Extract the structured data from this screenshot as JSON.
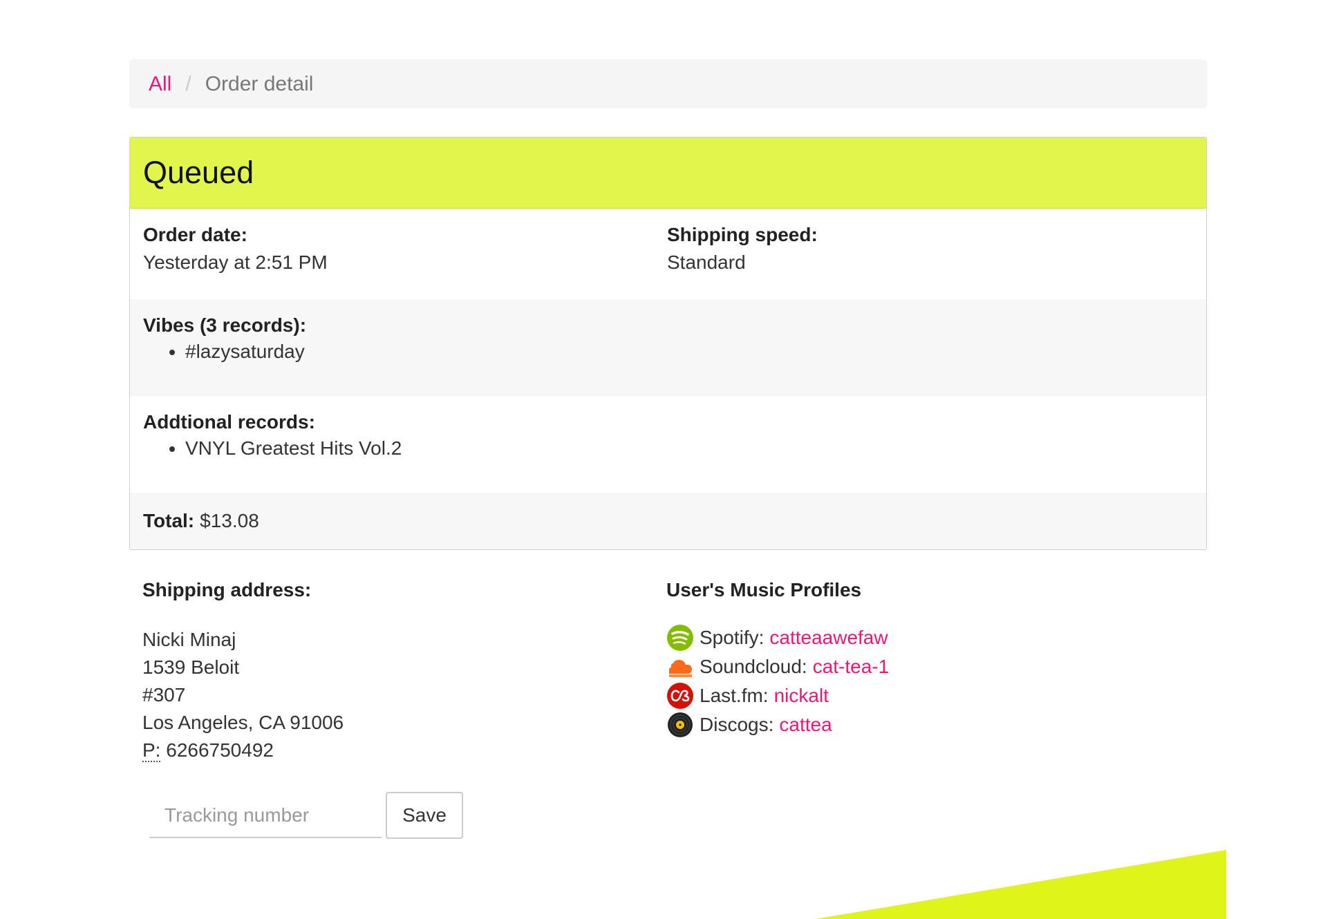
{
  "breadcrumb": {
    "all": "All",
    "separator": "/",
    "current": "Order detail"
  },
  "status": {
    "title": "Queued",
    "color": "#e1f54d"
  },
  "order": {
    "order_date_label": "Order date:",
    "order_date": "Yesterday at 2:51 PM",
    "shipping_speed_label": "Shipping speed:",
    "shipping_speed": "Standard",
    "vibes_label": "Vibes (3 records):",
    "vibes": [
      "#lazysaturday"
    ],
    "additional_label": "Addtional records:",
    "additional": [
      "VNYL Greatest Hits Vol.2"
    ],
    "total_label": "Total:",
    "total": "$13.08"
  },
  "shipping": {
    "label": "Shipping address:",
    "name": "Nicki Minaj",
    "street": "1539 Beloit",
    "unit": "#307",
    "city": "Los Angeles, CA 91006",
    "phone_label": "P:",
    "phone": "6266750492"
  },
  "profiles": {
    "label": "User's Music Profiles",
    "items": [
      {
        "service": "Spotify:",
        "user": "catteaawefaw",
        "icon": "spotify-icon"
      },
      {
        "service": "Soundcloud:",
        "user": "cat-tea-1",
        "icon": "soundcloud-icon"
      },
      {
        "service": "Last.fm:",
        "user": "nickalt",
        "icon": "lastfm-icon"
      },
      {
        "service": "Discogs:",
        "user": "cattea",
        "icon": "discogs-icon"
      }
    ]
  },
  "tracking": {
    "placeholder": "Tracking number",
    "value": "",
    "save_label": "Save"
  },
  "colors": {
    "accent": "#e8187a",
    "highlight": "#e1f54d",
    "decor": "#dff51a"
  }
}
